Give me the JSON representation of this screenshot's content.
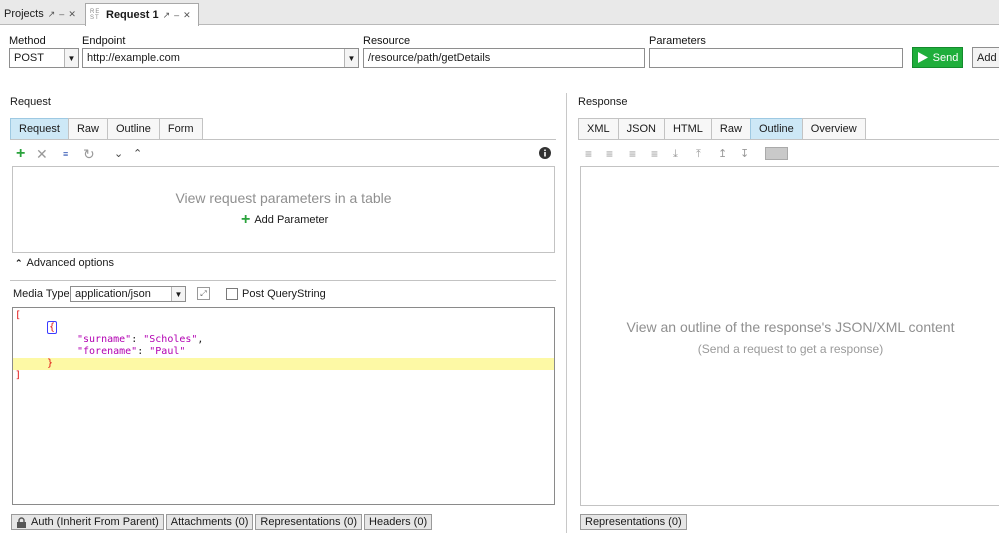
{
  "tabs": {
    "projects": "Projects",
    "request": "Request 1",
    "rest_badge": "RE ST"
  },
  "request_bar": {
    "method_label": "Method",
    "method_value": "POST",
    "endpoint_label": "Endpoint",
    "endpoint_value": "http://example.com",
    "resource_label": "Resource",
    "resource_value": "/resource/path/getDetails",
    "parameters_label": "Parameters",
    "parameters_value": "",
    "send_label": "Send",
    "add_label": "Add"
  },
  "request_panel": {
    "title": "Request",
    "tabs": [
      "Request",
      "Raw",
      "Outline",
      "Form"
    ],
    "empty_hint": "View request parameters in a table",
    "add_parameter": "Add Parameter",
    "advanced_options": "Advanced options",
    "media_type_label": "Media Type",
    "media_type_value": "application/json",
    "post_querystring_label": "Post QueryString",
    "code": {
      "open_bracket": "[",
      "open_brace": "{",
      "surname_key": "\"surname\"",
      "surname_value": "\"Scholes\"",
      "forename_key": "\"forename\"",
      "forename_value": "\"Paul\"",
      "close_brace": "}",
      "close_bracket": "]"
    },
    "bottom_tabs": [
      "Auth (Inherit From Parent)",
      "Attachments (0)",
      "Representations (0)",
      "Headers (0)"
    ]
  },
  "response_panel": {
    "title": "Response",
    "tabs": [
      "XML",
      "JSON",
      "HTML",
      "Raw",
      "Outline",
      "Overview"
    ],
    "hint_main": "View an outline of the response's JSON/XML content",
    "hint_sub": "(Send a request to get a response)",
    "bottom_tabs": [
      "Representations (0)"
    ]
  },
  "colors": {
    "send_green": "#1fae3b",
    "active_tab": "#cde8f6",
    "highlight_line": "#fdf9a5",
    "bracket_red": "#e01010",
    "json_magenta": "#b200b2"
  }
}
